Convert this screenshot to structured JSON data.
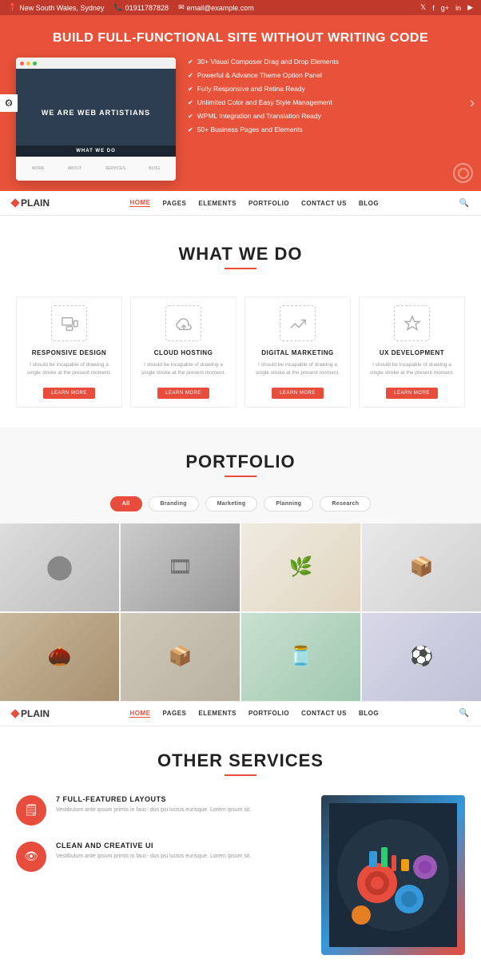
{
  "topbar": {
    "address": "New South Wales, Sydney",
    "phone": "01911787828",
    "email": "email@example.com",
    "social": [
      "twitter",
      "facebook",
      "google-plus",
      "instagram",
      "linkedin"
    ]
  },
  "hero": {
    "title": "BUILD FULL-FUNCTIONAL SITE WITHOUT WRITING CODE",
    "features": [
      "30+ Visual Composer Drag and Drop Elements",
      "Powerful & Advance Theme Option Panel",
      "Fully Responsive and Retina Ready",
      "Unlimited Color and Easy Style Management",
      "WPML Integration and Translation Ready",
      "50+ Business Pages and Elements"
    ],
    "mockup": {
      "headline": "WE ARE WEB ARTISTIANS",
      "subtitle": "WHAT WE DO"
    }
  },
  "navbar": {
    "logo": "PLAIN",
    "menu": [
      "HOME",
      "PAGES",
      "ELEMENTS",
      "PORTFOLIO",
      "CONTACT US",
      "BLOG"
    ]
  },
  "what_we_do": {
    "title": "WHAT WE DO",
    "services": [
      {
        "name": "RESPONSIVE DESIGN",
        "desc": "I should be incapable of drawing a single stroke at the present moment.",
        "btn": "Learn More"
      },
      {
        "name": "CLOUD HOSTING",
        "desc": "I should be incapable of drawing a single stroke at the present moment.",
        "btn": "Learn More"
      },
      {
        "name": "DIGITAL MARKETING",
        "desc": "I should be incapable of drawing a single stroke at the present moment.",
        "btn": "Learn More"
      },
      {
        "name": "UX DEVELOPMENT",
        "desc": "I should be incapable of drawing a single stroke at the present moment.",
        "btn": "Learn More"
      }
    ]
  },
  "portfolio": {
    "title": "PORTFOLIO",
    "filters": [
      "All",
      "Branding",
      "Marketing",
      "Planning",
      "Research"
    ],
    "active_filter": "All",
    "items": [
      {
        "color": "#c0c0c0",
        "emoji": "⬤"
      },
      {
        "color": "#888",
        "emoji": "📷"
      },
      {
        "color": "#d4c8b0",
        "emoji": "🌿"
      },
      {
        "color": "#ddd",
        "emoji": "📦"
      },
      {
        "color": "#b09070",
        "emoji": "🌰"
      },
      {
        "color": "#c0b8a0",
        "emoji": "📦"
      },
      {
        "color": "#a0c8b0",
        "emoji": "🫙"
      },
      {
        "color": "#d0d0e0",
        "emoji": "⚽"
      }
    ]
  },
  "other_services": {
    "title": "OTHER SERVICES",
    "services": [
      {
        "title": "7 FULL-FEATURED LAYOUTS",
        "desc": "Vestibulum ante ipsum primis in fauc- dus psi luctus eurisque. Lorem ipsum sit.",
        "icon": "🗒"
      },
      {
        "title": "CLEAN AND CREATIVE UI",
        "desc": "Vestibulum ante ipsum primis in fauc- dus psi luctus eurisque. Lorem ipsum sit.",
        "icon": "👁"
      }
    ]
  },
  "colors": {
    "primary": "#e74c3c",
    "dark": "#222",
    "light_gray": "#f8f8f8",
    "text_gray": "#999",
    "border": "#eee"
  }
}
